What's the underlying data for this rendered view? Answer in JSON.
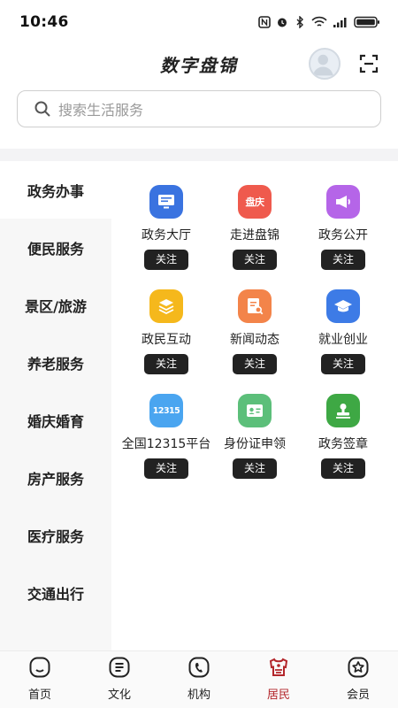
{
  "status_bar": {
    "time": "10:46"
  },
  "header": {
    "title": "数字盘锦"
  },
  "search": {
    "placeholder": "搜索生活服务"
  },
  "sidebar": {
    "items": [
      {
        "label": "政务办事",
        "active": true
      },
      {
        "label": "便民服务",
        "active": false
      },
      {
        "label": "景区/旅游",
        "active": false
      },
      {
        "label": "养老服务",
        "active": false
      },
      {
        "label": "婚庆婚育",
        "active": false
      },
      {
        "label": "房产服务",
        "active": false
      },
      {
        "label": "医疗服务",
        "active": false
      },
      {
        "label": "交通出行",
        "active": false
      }
    ]
  },
  "services": {
    "follow_label": "关注",
    "items": [
      {
        "label": "政务大厅",
        "icon": "monitor-icon",
        "color": "#3a73e0"
      },
      {
        "label": "走进盘锦",
        "icon": "city-badge-icon",
        "icon_text": "盘庆",
        "color": "#ef5a4d"
      },
      {
        "label": "政务公开",
        "icon": "megaphone-icon",
        "color": "#b565e8"
      },
      {
        "label": "政民互动",
        "icon": "layers-icon",
        "color": "#f5b81c"
      },
      {
        "label": "新闻动态",
        "icon": "news-search-icon",
        "color": "#f3844a"
      },
      {
        "label": "就业创业",
        "icon": "graduation-cap-icon",
        "color": "#3d7be6"
      },
      {
        "label": "全国12315平台",
        "icon": "hotline-12315-icon",
        "icon_text": "12315",
        "color": "#4aa5f0"
      },
      {
        "label": "身份证申领",
        "icon": "id-card-icon",
        "color": "#5cbf7a"
      },
      {
        "label": "政务签章",
        "icon": "stamp-icon",
        "color": "#3ea844"
      }
    ]
  },
  "tabbar": {
    "items": [
      {
        "label": "首页",
        "icon": "home-icon",
        "active": false
      },
      {
        "label": "文化",
        "icon": "culture-icon",
        "active": false
      },
      {
        "label": "机构",
        "icon": "institution-icon",
        "active": false
      },
      {
        "label": "居民",
        "icon": "resident-icon",
        "active": true
      },
      {
        "label": "会员",
        "icon": "member-icon",
        "active": false
      }
    ],
    "active_color": "#b3262b"
  }
}
